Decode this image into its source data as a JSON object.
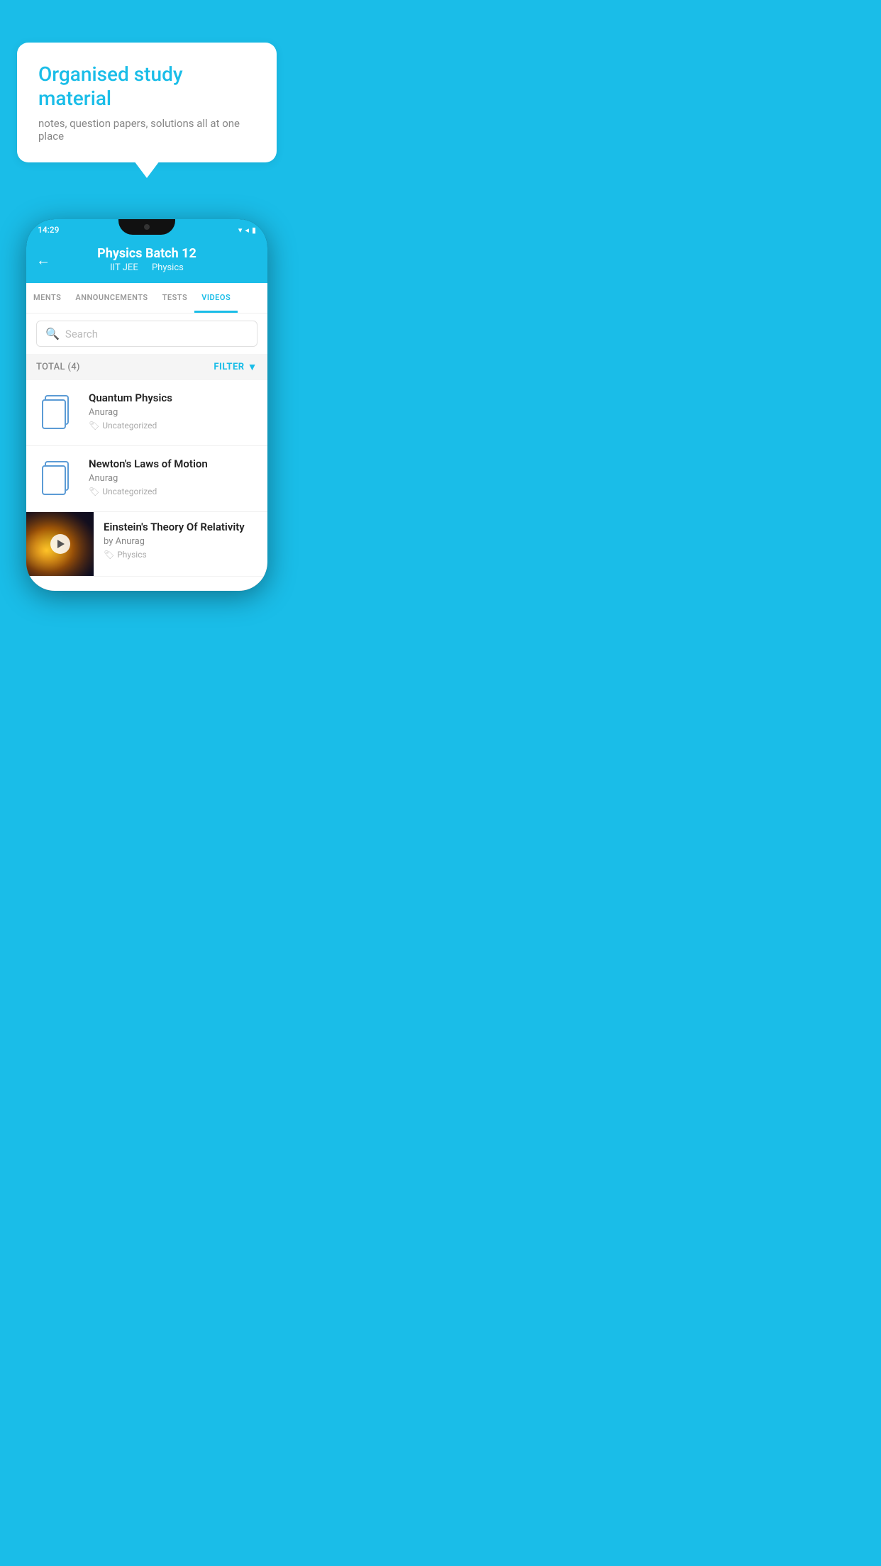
{
  "background_color": "#1ABDE8",
  "speech_bubble": {
    "title": "Organised study material",
    "subtitle": "notes, question papers, solutions all at one place"
  },
  "phone": {
    "status_bar": {
      "time": "14:29",
      "icons": "▾◂▮"
    },
    "header": {
      "back_label": "←",
      "title": "Physics Batch 12",
      "subtitle_left": "IIT JEE",
      "subtitle_right": "Physics"
    },
    "tabs": [
      {
        "label": "MENTS",
        "active": false
      },
      {
        "label": "ANNOUNCEMENTS",
        "active": false
      },
      {
        "label": "TESTS",
        "active": false
      },
      {
        "label": "VIDEOS",
        "active": true
      }
    ],
    "search": {
      "placeholder": "Search"
    },
    "filter_row": {
      "total_label": "TOTAL (4)",
      "filter_label": "FILTER"
    },
    "video_items": [
      {
        "title": "Quantum Physics",
        "author": "Anurag",
        "tag": "Uncategorized",
        "has_thumbnail": false
      },
      {
        "title": "Newton's Laws of Motion",
        "author": "Anurag",
        "tag": "Uncategorized",
        "has_thumbnail": false
      },
      {
        "title": "Einstein's Theory Of Relativity",
        "author": "by Anurag",
        "tag": "Physics",
        "has_thumbnail": true
      }
    ]
  }
}
